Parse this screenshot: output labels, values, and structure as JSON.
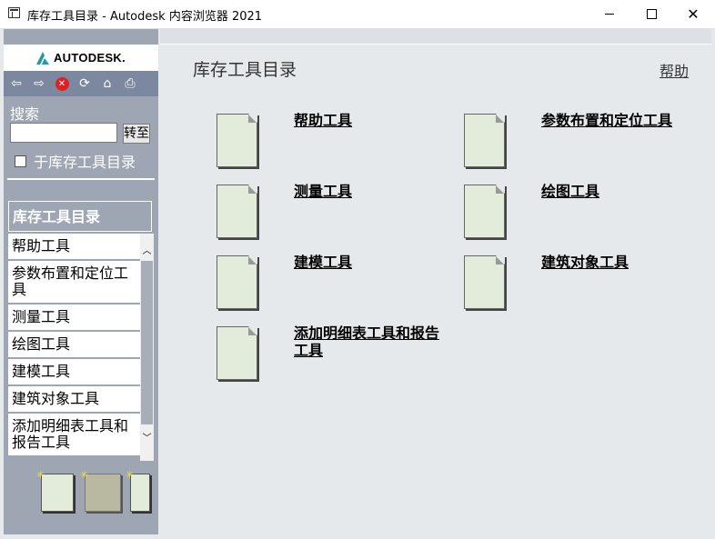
{
  "window": {
    "title": "库存工具目录 - Autodesk 内容浏览器 2021",
    "min_glyph": "",
    "max_glyph": "",
    "close_glyph": "✕"
  },
  "sidebar": {
    "logo_text": "AUTODESK.",
    "toolbar": [
      {
        "name": "back-arrow-icon",
        "glyph": "⇦"
      },
      {
        "name": "forward-arrow-icon",
        "glyph": "⇨"
      },
      {
        "name": "stop-icon",
        "glyph": "✕"
      },
      {
        "name": "refresh-icon",
        "glyph": "⟳"
      },
      {
        "name": "home-icon",
        "glyph": "⌂"
      },
      {
        "name": "print-icon",
        "glyph": "⎙"
      }
    ],
    "search_label": "搜索",
    "search_value": "",
    "go_label": "转至",
    "checkbox_label": "于库存工具目录",
    "nav_header": "库存工具目录",
    "nav_items": [
      "帮助工具",
      "参数布置和定位工具",
      "测量工具",
      "绘图工具",
      "建模工具",
      "建筑对象工具",
      "添加明细表工具和报告工具"
    ]
  },
  "main": {
    "title": "库存工具目录",
    "help_label": "帮助",
    "tools": [
      "帮助工具",
      "参数布置和定位工具",
      "测量工具",
      "绘图工具",
      "建模工具",
      "建筑对象工具",
      "添加明细表工具和报告工具"
    ]
  },
  "colors": {
    "sidebar_bg": "#9ea6b3",
    "toolbar_bg": "#7c88a0",
    "main_bg": "#e6e9ec",
    "doc_fill": "#e3ecdb",
    "logo_accent": "#1f9aa6"
  }
}
